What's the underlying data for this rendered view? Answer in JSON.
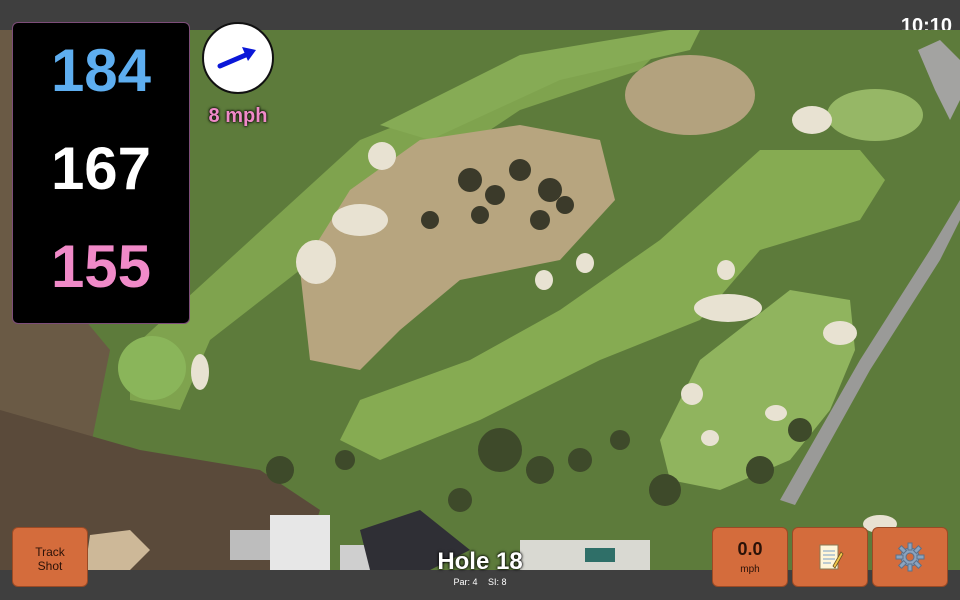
{
  "status": {
    "time": "10:10"
  },
  "distances": {
    "back": "184",
    "middle": "167",
    "front": "155"
  },
  "wind": {
    "speed_label": "8 mph",
    "direction_icon": "wind-arrow-icon",
    "color": "#f08ac8"
  },
  "hole": {
    "title": "Hole 18",
    "par_label": "Par: 4",
    "si_label": "SI: 8"
  },
  "buttons": {
    "track_shot_line1": "Track",
    "track_shot_line2": "Shot",
    "mph_value": "0.0",
    "mph_unit": "mph",
    "notes_icon": "notepad-icon",
    "settings_icon": "gear-icon"
  },
  "colors": {
    "back_distance": "#5eaef0",
    "middle_distance": "#ffffff",
    "front_distance": "#f08ac8",
    "button": "#d46c3c",
    "panel": "#000000"
  }
}
